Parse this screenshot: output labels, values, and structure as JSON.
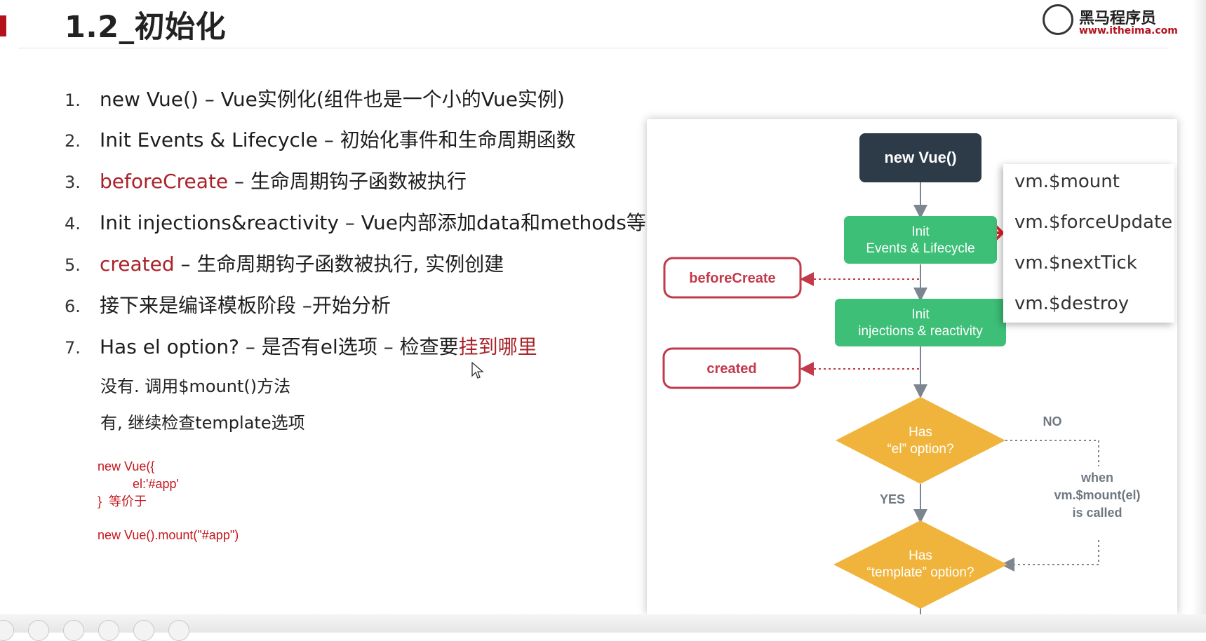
{
  "slide": {
    "title": "1.2_初始化",
    "logo": {
      "name": "黑马程序员",
      "url": "www.itheima.com"
    },
    "items": [
      {
        "num": "1.",
        "text": "new Vue() – Vue实例化(组件也是一个小的Vue实例)"
      },
      {
        "num": "2.",
        "text": "Init Events & Lifecycle – 初始化事件和生命周期函数"
      },
      {
        "num": "3.",
        "highlight": "beforeCreate",
        "text": " – 生命周期钩子函数被执行"
      },
      {
        "num": "4.",
        "text": "Init injections&reactivity – Vue内部添加data和methods等"
      },
      {
        "num": "5.",
        "highlight": "created",
        "text": " – 生命周期钩子函数被执行, 实例创建"
      },
      {
        "num": "6.",
        "text": "接下来是编译模板阶段 –开始分析"
      },
      {
        "num": "7.",
        "text": "Has el option? – 是否有el选项 – 检查要",
        "highlight_end": "挂到哪里"
      }
    ],
    "sub_items": [
      "没有. 调用$mount()方法",
      "有, 继续检查template选项"
    ],
    "code": {
      "line1": "new Vue({",
      "line2": "el:'#app'",
      "line3": "}  等价于",
      "line4": "new Vue().mount(\"#app\")"
    }
  },
  "diagram": {
    "new_vue": "new Vue()",
    "init_events_1": "Init",
    "init_events_2": "Events & Lifecycle",
    "before_create": "beforeCreate",
    "init_inject_1": "Init",
    "init_inject_2": "injections & reactivity",
    "created": "created",
    "has_el_1": "Has",
    "has_el_2": "“el” option?",
    "no_label": "NO",
    "yes_label": "YES",
    "when_1": "when",
    "when_2": "vm.$mount(el)",
    "when_3": "is called",
    "has_template_1": "Has",
    "has_template_2": "“template” option?"
  },
  "popup": {
    "items": [
      "vm.$mount",
      "vm.$forceUpdate",
      "vm.$nextTick",
      "vm.$destroy"
    ]
  },
  "colors": {
    "accent_red": "#a8232a",
    "green_box": "#3dbf77",
    "dark_box": "#2d3a48",
    "yellow_diamond": "#f0b43c",
    "code_red": "#c4161c"
  }
}
